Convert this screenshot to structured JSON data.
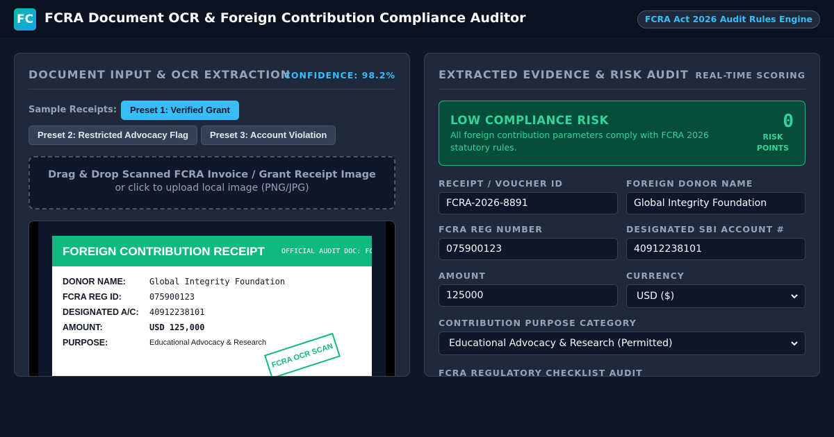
{
  "header": {
    "logo": "FC",
    "title": "FCRA Document OCR & Foreign Contribution Compliance Auditor",
    "badge": "FCRA Act 2026 Audit Rules Engine"
  },
  "input_panel": {
    "title": "DOCUMENT INPUT & OCR EXTRACTION",
    "confidence": "CONFIDENCE: 98.2%",
    "presets_label": "Sample Receipts:",
    "presets": [
      {
        "label": "Preset 1: Verified Grant",
        "active": true
      },
      {
        "label": "Preset 2: Restricted Advocacy Flag",
        "active": false
      },
      {
        "label": "Preset 3: Account Violation",
        "active": false
      }
    ],
    "dropzone": {
      "title": "Drag & Drop Scanned FCRA Invoice / Grant Receipt Image",
      "subtitle": "or click to upload local image (PNG/JPG)"
    },
    "receipt": {
      "title": "FOREIGN CONTRIBUTION RECEIPT",
      "doc_ref": "OFFICIAL AUDIT DOC: FCRA-",
      "rows": [
        {
          "label": "DONOR NAME:",
          "value": "Global Integrity Foundation"
        },
        {
          "label": "FCRA REG ID:",
          "value": "075900123"
        },
        {
          "label": "DESIGNATED A/C:",
          "value": "40912238101"
        },
        {
          "label": "AMOUNT:",
          "value": "USD 125,000"
        },
        {
          "label": "PURPOSE:",
          "value": "Educational Advocacy & Research"
        }
      ],
      "stamp": "FCRA OCR SCAN"
    }
  },
  "audit_panel": {
    "title": "EXTRACTED EVIDENCE & RISK AUDIT",
    "meta": "REAL-TIME SCORING",
    "risk": {
      "level": "LOW COMPLIANCE RISK",
      "description": "All foreign contribution parameters comply with FCRA 2026 statutory rules.",
      "score": "0",
      "unit_line1": "RISK",
      "unit_line2": "POINTS",
      "color": "#34d399"
    },
    "fields": {
      "receipt_id": {
        "label": "RECEIPT / VOUCHER ID",
        "value": "FCRA-2026-8891"
      },
      "donor_name": {
        "label": "FOREIGN DONOR NAME",
        "value": "Global Integrity Foundation"
      },
      "fcra_reg": {
        "label": "FCRA REG NUMBER",
        "value": "075900123"
      },
      "sbi_account": {
        "label": "DESIGNATED SBI ACCOUNT #",
        "value": "40912238101"
      },
      "amount": {
        "label": "AMOUNT",
        "value": "125000"
      },
      "currency": {
        "label": "CURRENCY",
        "value": "USD ($)"
      },
      "purpose": {
        "label": "CONTRIBUTION PURPOSE CATEGORY",
        "value": "Educational Advocacy & Research (Permitted)"
      }
    },
    "checklist_title": "FCRA REGULATORY CHECKLIST AUDIT"
  },
  "colors": {
    "accent": "#38bdf8",
    "success": "#10b981",
    "background": "#0f172a",
    "panel": "#1e293b"
  }
}
